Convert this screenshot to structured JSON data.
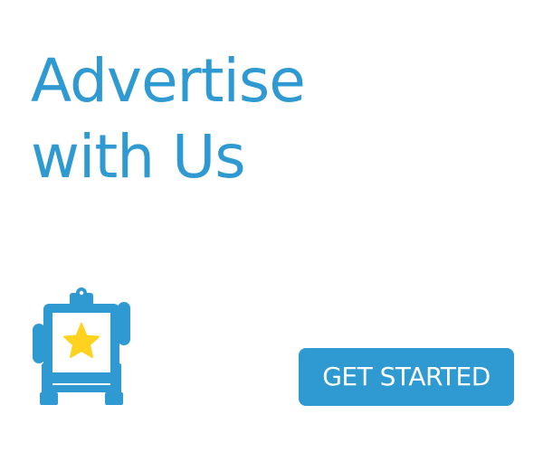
{
  "headline": {
    "line1": "Advertise",
    "line2": "with Us"
  },
  "cta": {
    "label": "GET STARTED"
  },
  "icon": {
    "name": "easel-star-icon"
  },
  "colors": {
    "brand_blue": "#2f9ad2",
    "star_yellow": "#ffd21f",
    "background": "#ffffff"
  }
}
